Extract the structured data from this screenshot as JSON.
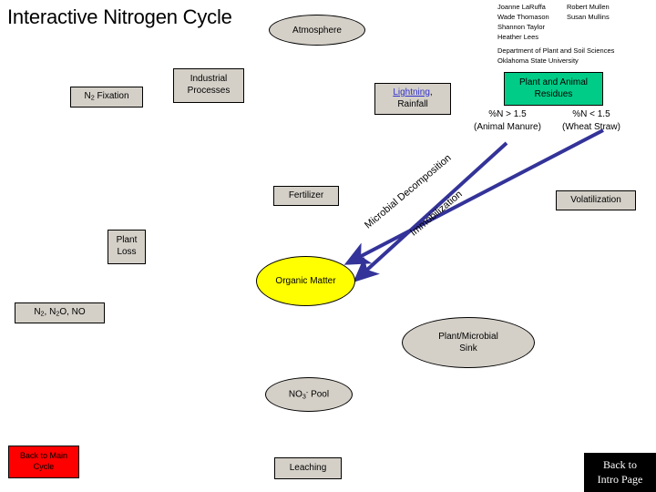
{
  "slide": {
    "title": "Interactive Nitrogen Cycle",
    "authors": [
      {
        "left": "Joanne LaRuffa",
        "right": "Robert Mullen"
      },
      {
        "left": "Wade Thomason",
        "right": "Susan Mullins"
      },
      {
        "left": "Shannon Taylor",
        "right": ""
      },
      {
        "left": "Heather Lees",
        "right": ""
      }
    ],
    "affiliation": {
      "department": "Department of Plant and Soil Sciences",
      "university": "Oklahoma State University"
    }
  },
  "nodes": {
    "atmosphere": "Atmosphere",
    "n2_fixation_pre": "N",
    "n2_fixation_sub": "2",
    "n2_fixation_post": " Fixation",
    "industrial_processes": "Industrial Processes",
    "lightning_link": "Lightning",
    "lightning_comma": ",",
    "rainfall": "Rainfall",
    "plant_animal_residues": "Plant and Animal Residues",
    "pct_n_high": "%N > 1.5",
    "pct_n_high_source": "(Animal Manure)",
    "pct_n_low": "%N < 1.5",
    "pct_n_low_source": "(Wheat Straw)",
    "fertilizer": "Fertilizer",
    "volatilization": "Volatilization",
    "plant_loss_line1": "Plant",
    "plant_loss_line2": "Loss",
    "organic_matter": "Organic Matter",
    "gaseous_losses_pre": "N",
    "gaseous_losses_sub1": "2",
    "gaseous_losses_mid": ", N",
    "gaseous_losses_sub2": "2",
    "gaseous_losses_post": "O, NO",
    "sink_line1": "Plant/Microbial",
    "sink_line2": "Sink",
    "no3_pool_pre": "NO",
    "no3_pool_sub": "3",
    "no3_pool_sup": "-",
    "no3_pool_post": " Pool",
    "leaching": "Leaching"
  },
  "arrow_labels": {
    "microbial_decomposition": "Microbial Decomposition",
    "immobilization": "Immobilization"
  },
  "buttons": {
    "back_to_main_line1": "Back to Main",
    "back_to_main_line2": "Cycle",
    "back_to_intro_line1": "Back to",
    "back_to_intro_line2": "Intro Page"
  },
  "colors": {
    "shape_fill": "#d4d0c8",
    "residues_fill": "#00cc88",
    "organic_matter_fill": "#ffff00",
    "arrow_blue": "#333399",
    "link_blue": "#3333cc",
    "back_main_fill": "#ff0000",
    "back_intro_fill": "#000000"
  }
}
